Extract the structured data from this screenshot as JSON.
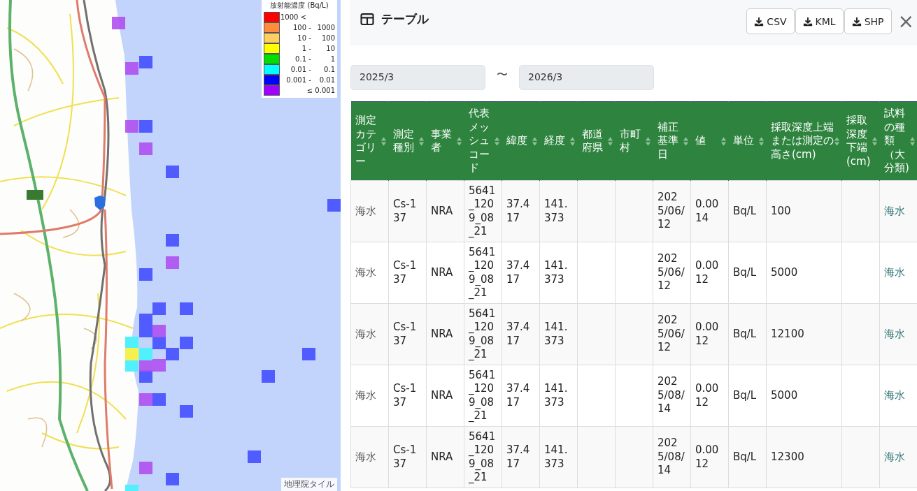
{
  "map": {
    "kind": "picture",
    "legend": {
      "title": "放射能濃度 (Bq/L)",
      "items": [
        {
          "low": "1000 <",
          "color": "#ff0000"
        },
        {
          "low": "100",
          "sep": "-",
          "high": "1000",
          "color": "#ff8c3c"
        },
        {
          "low": "10",
          "sep": "-",
          "high": "100",
          "color": "#ffd060"
        },
        {
          "low": "1",
          "sep": "-",
          "high": "10",
          "color": "#ffff00"
        },
        {
          "low": "0.1",
          "sep": "-",
          "high": "1",
          "color": "#00e000"
        },
        {
          "low": "0.01",
          "sep": "-",
          "high": "0.1",
          "color": "#00ffff"
        },
        {
          "low": "0.001",
          "sep": "-",
          "high": "0.01",
          "color": "#0000ff"
        },
        {
          "high": "≤ 0.001",
          "color": "#a000ff"
        }
      ]
    },
    "attribution": "地理院タイル"
  },
  "panel": {
    "title": "テーブル",
    "buttons": [
      "CSV",
      "KML",
      "SHP"
    ],
    "close": "×",
    "date_from": "2025/3",
    "separator": "〜",
    "date_to": "2026/3",
    "table": {
      "columns": [
        "測定カテゴリー",
        "測定種別",
        "事業者",
        "代表メッシュコード",
        "緯度",
        "経度",
        "都道府県",
        "市町村",
        "補正基準日",
        "値",
        "単位",
        "採取深度上端または測定の高さ(cm)",
        "採取深度下端(cm)",
        "試料の種類（大分類)"
      ],
      "rows": [
        [
          "海水",
          "Cs-137",
          "NRA",
          "5641_1209_08_21",
          "37.417",
          "141.373",
          null,
          null,
          "2025/06/12",
          "0.0014",
          "Bq/L",
          "100",
          null,
          "海水"
        ],
        [
          "海水",
          "Cs-137",
          "NRA",
          "5641_1209_08_21",
          "37.417",
          "141.373",
          null,
          null,
          "2025/06/12",
          "0.0012",
          "Bq/L",
          "5000",
          null,
          "海水"
        ],
        [
          "海水",
          "Cs-137",
          "NRA",
          "5641_1209_08_21",
          "37.417",
          "141.373",
          null,
          null,
          "2025/06/12",
          "0.0012",
          "Bq/L",
          "12100",
          null,
          "海水"
        ],
        [
          "海水",
          "Cs-137",
          "NRA",
          "5641_1209_08_21",
          "37.417",
          "141.373",
          null,
          null,
          "2025/08/14",
          "0.0012",
          "Bq/L",
          "5000",
          null,
          "海水"
        ],
        [
          "海水",
          "Cs-137",
          "NRA",
          "5641_1209_08_21",
          "37.417",
          "141.373",
          null,
          null,
          "2025/08/14",
          "0.0012",
          "Bq/L",
          "12300",
          null,
          "海水"
        ]
      ]
    }
  }
}
